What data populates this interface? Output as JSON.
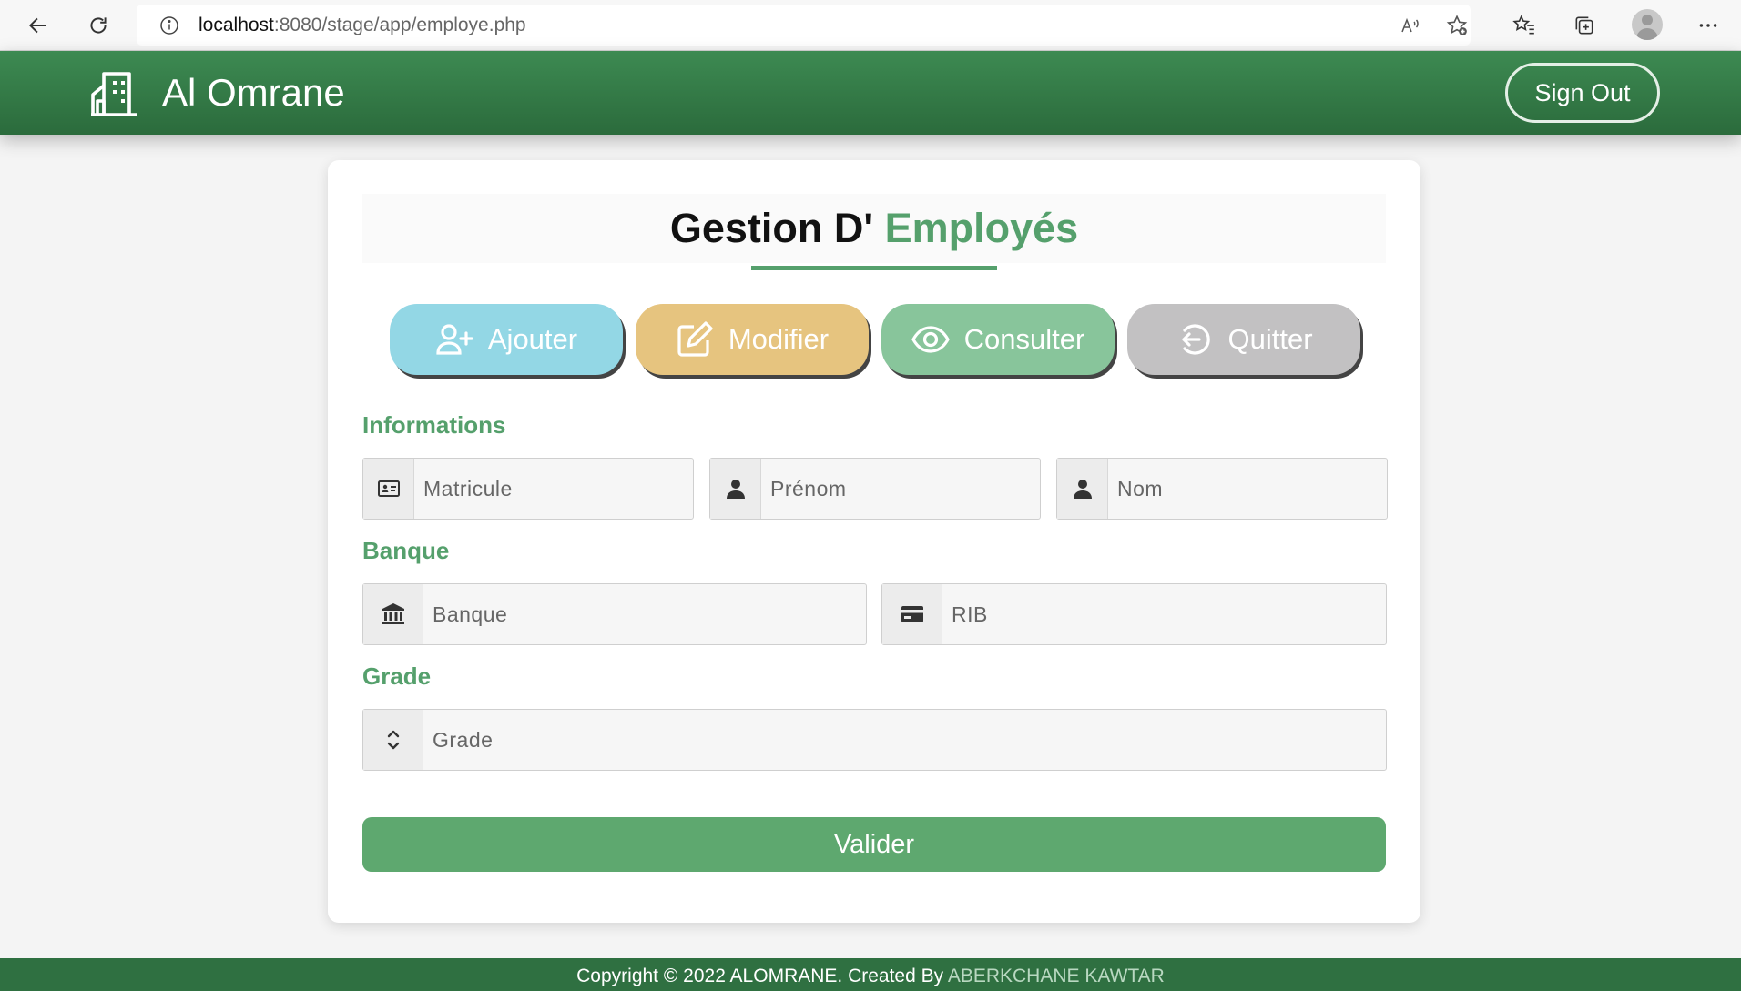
{
  "browser": {
    "url_host": "localhost",
    "url_rest": ":8080/stage/app/employe.php"
  },
  "header": {
    "brand": "Al Omrane",
    "signout_label": "Sign Out",
    "bg_color": "#2f7041"
  },
  "page": {
    "title_prefix": "Gestion D'",
    "title_accent": "Employés",
    "accent_color": "#55a06c"
  },
  "actions": [
    {
      "label": "Ajouter",
      "icon": "user-plus-icon",
      "color": "#93d7e5"
    },
    {
      "label": "Modifier",
      "icon": "edit-icon",
      "color": "#e6c47f"
    },
    {
      "label": "Consulter",
      "icon": "eye-icon",
      "color": "#88c59b"
    },
    {
      "label": "Quitter",
      "icon": "exit-icon",
      "color": "#c2c1c2"
    }
  ],
  "sections": {
    "informations": "Informations",
    "banque": "Banque",
    "grade": "Grade"
  },
  "fields": {
    "matricule": {
      "placeholder": "Matricule",
      "icon": "id-card-icon"
    },
    "prenom": {
      "placeholder": "Prénom",
      "icon": "user-icon"
    },
    "nom": {
      "placeholder": "Nom",
      "icon": "user-icon"
    },
    "banque": {
      "placeholder": "Banque",
      "icon": "bank-icon"
    },
    "rib": {
      "placeholder": "RIB",
      "icon": "credit-card-icon"
    },
    "grade": {
      "placeholder": "Grade",
      "icon": "sort-icon"
    }
  },
  "submit_label": "Valider",
  "footer": {
    "text": "Copyright © 2022 ALOMRANE. Created By ",
    "author": "ABERKCHANE KAWTAR"
  }
}
